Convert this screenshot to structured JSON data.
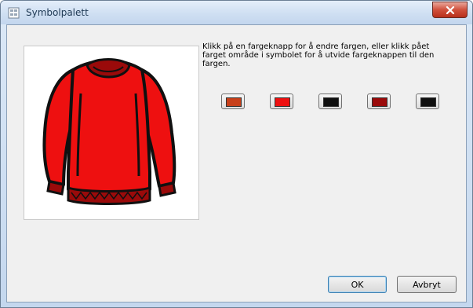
{
  "window": {
    "title": "Symbolpalett"
  },
  "instructions": "Klikk på en fargeknapp for å endre fargen, eller klikk pået farget område i symbolet for å utvide fargeknappen til den fargen.",
  "swatches": [
    {
      "color": "#c8401a"
    },
    {
      "color": "#ee1010"
    },
    {
      "color": "#101010"
    },
    {
      "color": "#9a0a0a"
    },
    {
      "color": "#101010"
    }
  ],
  "symbol": {
    "icon": "sweater-icon",
    "body_color": "#ee1010",
    "trim_color": "#9a0a0a",
    "outline_color": "#101010"
  },
  "buttons": {
    "ok_label": "OK",
    "cancel_label": "Avbryt"
  }
}
